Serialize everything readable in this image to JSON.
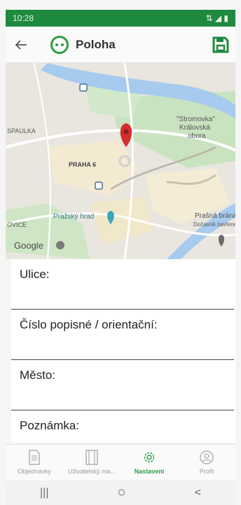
{
  "status": {
    "time": "10:28",
    "icons": "⇅ ◢ ▮"
  },
  "header": {
    "back_icon": "arrow-left-icon",
    "title": "Poloha",
    "save_icon": "floppy-disk-icon",
    "accent": "#2e9d47"
  },
  "map": {
    "labels": {
      "stromovka": "\"Stromovka\"",
      "kralovska": "Královská",
      "obora": "obora",
      "spaulka": "SPAULKA",
      "praha6": "PRAHA 6",
      "hrad": "Pražský hrad",
      "brana": "Prašná brána",
      "docasne": "Dočasně zavřeno",
      "ovice": "OVICE",
      "google": "Google"
    }
  },
  "form": {
    "fields": [
      {
        "label": "Ulice:",
        "value": ""
      },
      {
        "label": "Číslo popisné / orientační:",
        "value": ""
      },
      {
        "label": "Město:",
        "value": ""
      },
      {
        "label": "Poznámka:",
        "value": ""
      }
    ]
  },
  "nav": {
    "items": [
      {
        "label": "Objednávky",
        "icon": "document-icon",
        "active": false
      },
      {
        "label": "Uživatelský ma...",
        "icon": "book-icon",
        "active": false
      },
      {
        "label": "Nastavení",
        "icon": "gear-icon",
        "active": true
      },
      {
        "label": "Profil",
        "icon": "profile-icon",
        "active": false
      }
    ]
  },
  "system_nav": {
    "recents": "|||",
    "home": "○",
    "back": "<"
  }
}
